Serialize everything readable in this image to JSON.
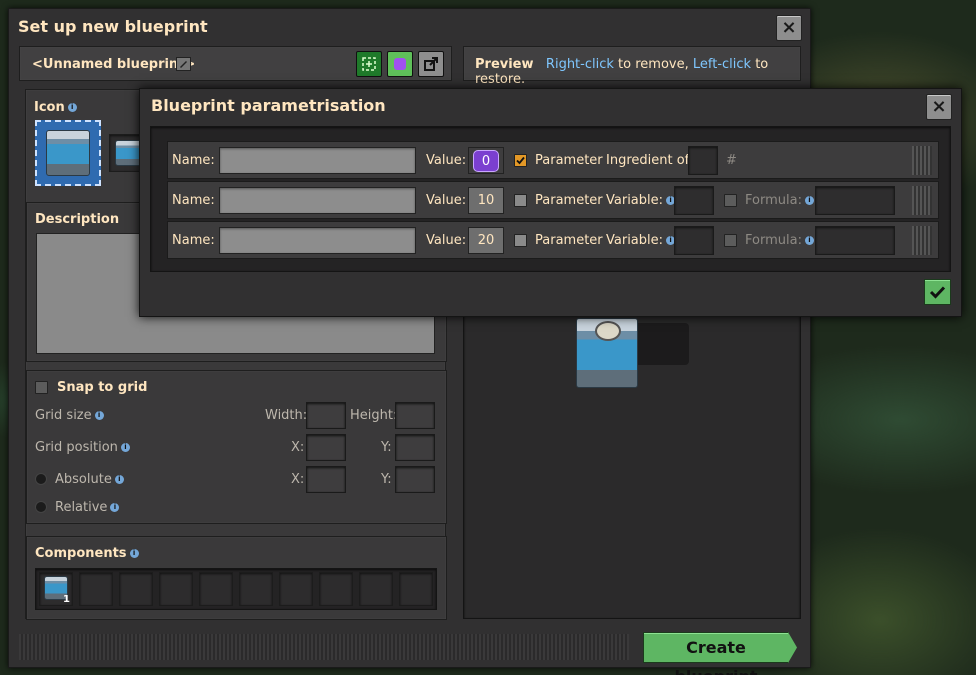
{
  "main": {
    "title": "Set up new blueprint",
    "blueprint_name": "<Unnamed blueprint>",
    "preview": {
      "label": "Preview",
      "hint_rc": "Right-click",
      "hint_rc_rest": " to remove, ",
      "hint_lc": "Left-click",
      "hint_lc_rest": " to restore."
    },
    "icon_label": "Icon",
    "description_label": "Description",
    "snap": {
      "label": "Snap to grid",
      "grid_size": "Grid size",
      "width": "Width:",
      "height": "Height:",
      "grid_position": "Grid position",
      "x": "X:",
      "y": "Y:",
      "absolute": "Absolute",
      "relative": "Relative"
    },
    "components": {
      "label": "Components",
      "count": "1"
    },
    "create_button": "Create blueprint"
  },
  "param": {
    "title": "Blueprint parametrisation",
    "rows": [
      {
        "name_label": "Name:",
        "name_value": "",
        "value_label": "Value:",
        "value": "0",
        "param_label": "Parameter",
        "param_checked": true,
        "extra_label": "Ingredient of:",
        "hash": "#"
      },
      {
        "name_label": "Name:",
        "name_value": "",
        "value_label": "Value:",
        "value": "10",
        "param_label": "Parameter",
        "param_checked": false,
        "extra_label": "Variable:",
        "formula_label": "Formula:"
      },
      {
        "name_label": "Name:",
        "name_value": "",
        "value_label": "Value:",
        "value": "20",
        "param_label": "Parameter",
        "param_checked": false,
        "extra_label": "Variable:",
        "formula_label": "Formula:"
      }
    ]
  },
  "icons": {
    "close": "close-icon",
    "edit": "pencil-icon",
    "select": "selection-icon",
    "color": "color-icon",
    "export": "export-icon",
    "confirm": "checkmark-icon",
    "machine": "assembling-machine-icon",
    "info": "info-icon"
  },
  "colors": {
    "accent_green": "#5eb663",
    "hint_blue": "#7fc7ff",
    "checkbox_orange": "#e39827",
    "parameter_purple": "#7b3fd0"
  }
}
